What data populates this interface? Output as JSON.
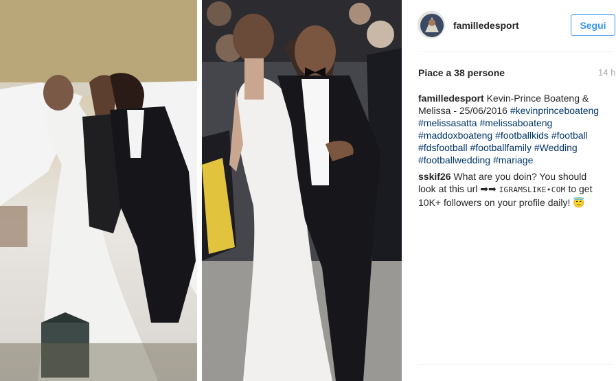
{
  "post": {
    "username": "familledesport",
    "follow_label": "Segui",
    "likes": "Piace a 38 persone",
    "time": "14 h"
  },
  "caption": {
    "user": "familledesport",
    "text": "Kevin-Prince Boateng & Melissa - 25/06/2016",
    "hashtags": [
      "#kevinprinceboateng",
      "#melissasatta",
      "#melissaboateng",
      "#maddoxboateng",
      "#footballkids",
      "#football",
      "#fdsfootball",
      "#footballfamily",
      "#Wedding",
      "#footballwedding",
      "#mariage"
    ]
  },
  "comment": {
    "user": "sskif26",
    "text_before": "What are you doin? You should look at this url",
    "arrows": "➡➡",
    "url": "IGRAMSLIKE•COM",
    "text_after": "to get 10K+ followers on your profile daily!",
    "emoji": "😇"
  },
  "icons": {
    "avatar": "profile-avatar-icon",
    "arrow": "right-arrow-icon",
    "emoji": "smiling-face-with-halo-icon"
  },
  "colors": {
    "accent": "#3897f0",
    "hashtag": "#003569",
    "muted": "#a5a7aa"
  }
}
